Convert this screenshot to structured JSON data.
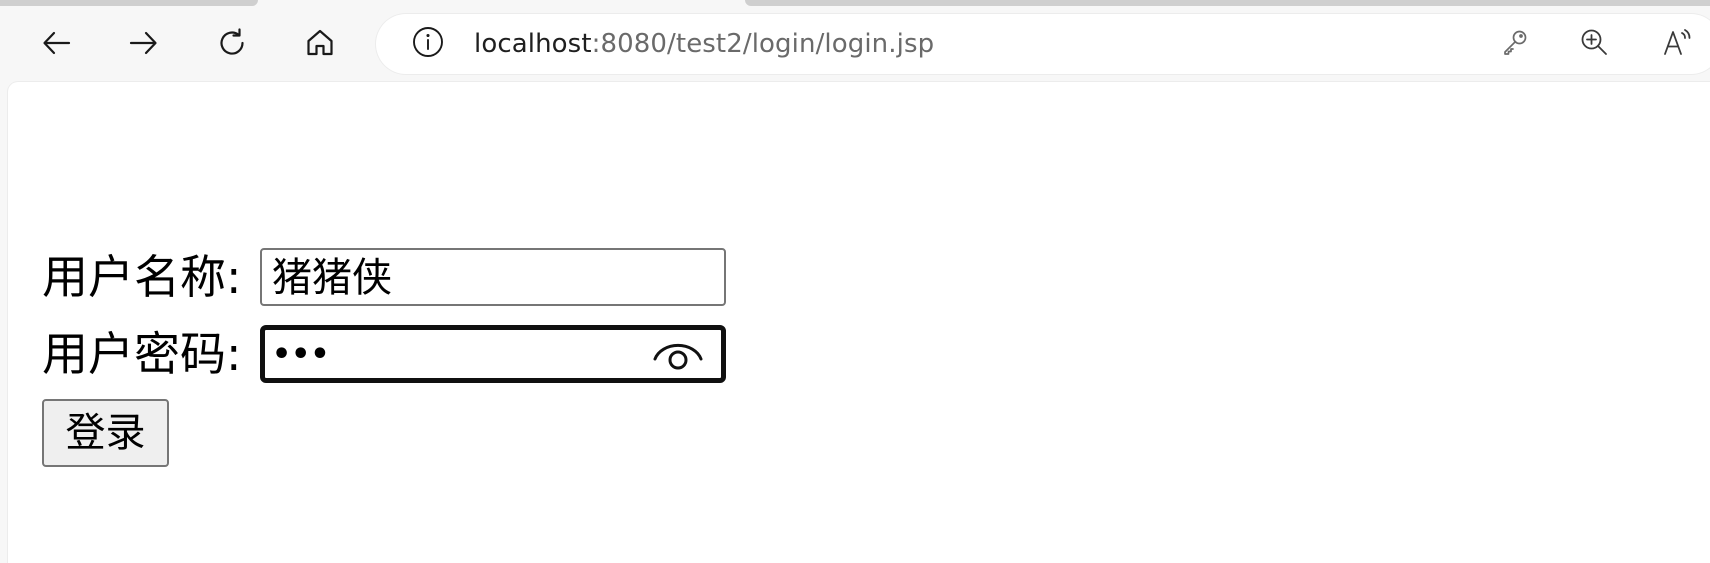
{
  "browser": {
    "address": {
      "host": "localhost",
      "rest": ":8080/test2/login/login.jsp"
    },
    "icons": {
      "back": "arrow-left-icon",
      "forward": "arrow-right-icon",
      "refresh": "refresh-icon",
      "home": "home-icon",
      "site_info": "info-circle-icon",
      "passwords": "key-icon",
      "zoom": "zoom-in-icon",
      "read_aloud": "read-aloud-icon"
    }
  },
  "form": {
    "username": {
      "label": "用户名称:",
      "value": "猪猪侠"
    },
    "password": {
      "label": "用户密码:",
      "masked_value": "•••",
      "reveal_icon": "eye-icon"
    },
    "submit_label": "登录"
  },
  "colors": {
    "chrome_bg": "#f7f7f7",
    "page_bg": "#ffffff",
    "url_host": "#1f1f1f",
    "url_path": "#6a6a6a",
    "field_border": "#767676",
    "focus_border": "#101010",
    "button_bg": "#efefef"
  }
}
